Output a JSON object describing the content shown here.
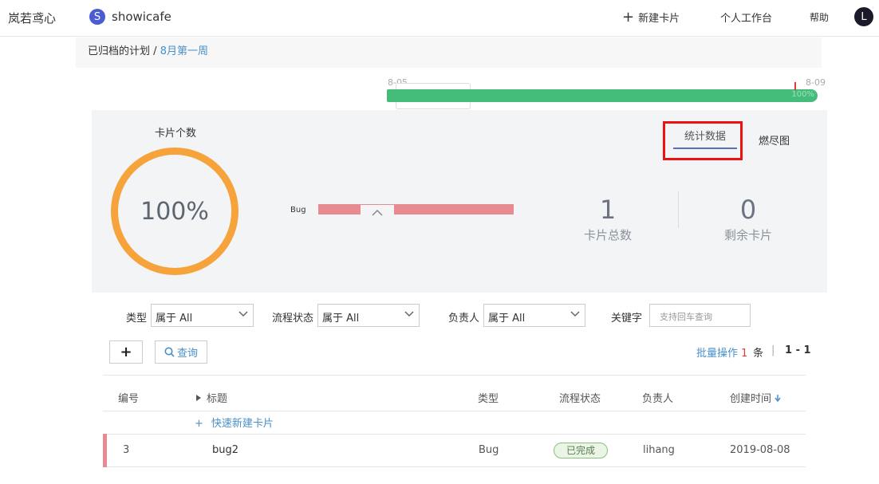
{
  "topbar": {
    "brand": "岚若鸢心",
    "project_initial": "S",
    "project_name": "showicafe",
    "new_card": "新建卡片",
    "workspace": "个人工作台",
    "help": "帮助",
    "avatar_initial": "L"
  },
  "breadcrumb": {
    "parent": "已归档的计划",
    "separator": "/",
    "current": "8月第一周"
  },
  "timeline": {
    "start": "8-05",
    "end": "8-09",
    "progress_label": "100%",
    "progress": 1.0,
    "bar_color": "#44bd7a"
  },
  "stats": {
    "circle_title": "卡片个数",
    "circle_value": "100%",
    "circle_fraction": 1.0,
    "circle_color": "#f5a33a",
    "bug_label": "Bug",
    "total_num": "1",
    "total_label": "卡片总数",
    "remaining_num": "0",
    "remaining_label": "剩余卡片",
    "tab_stats": "统计数据",
    "tab_burndown": "燃尽图"
  },
  "filters": {
    "type_label": "类型",
    "type_value": "属于 All",
    "status_label": "流程状态",
    "status_value": "属于 All",
    "owner_label": "负责人",
    "owner_value": "属于 All",
    "keyword_label": "关键字",
    "keyword_placeholder": "支持回车查询"
  },
  "actions": {
    "add": "+",
    "query": "查询",
    "batch": "批量操作",
    "batch_count": "1",
    "batch_unit": "条",
    "separator": "|",
    "range": "1 - 1"
  },
  "table": {
    "headers": {
      "id": "编号",
      "title": "标题",
      "type": "类型",
      "status": "流程状态",
      "owner": "负责人",
      "created": "创建时间"
    },
    "quick_add": "快速新建卡片",
    "rows": [
      {
        "id": "3",
        "title": "bug2",
        "type": "Bug",
        "status": "已完成",
        "owner": "lihang",
        "created": "2019-08-08"
      }
    ]
  }
}
